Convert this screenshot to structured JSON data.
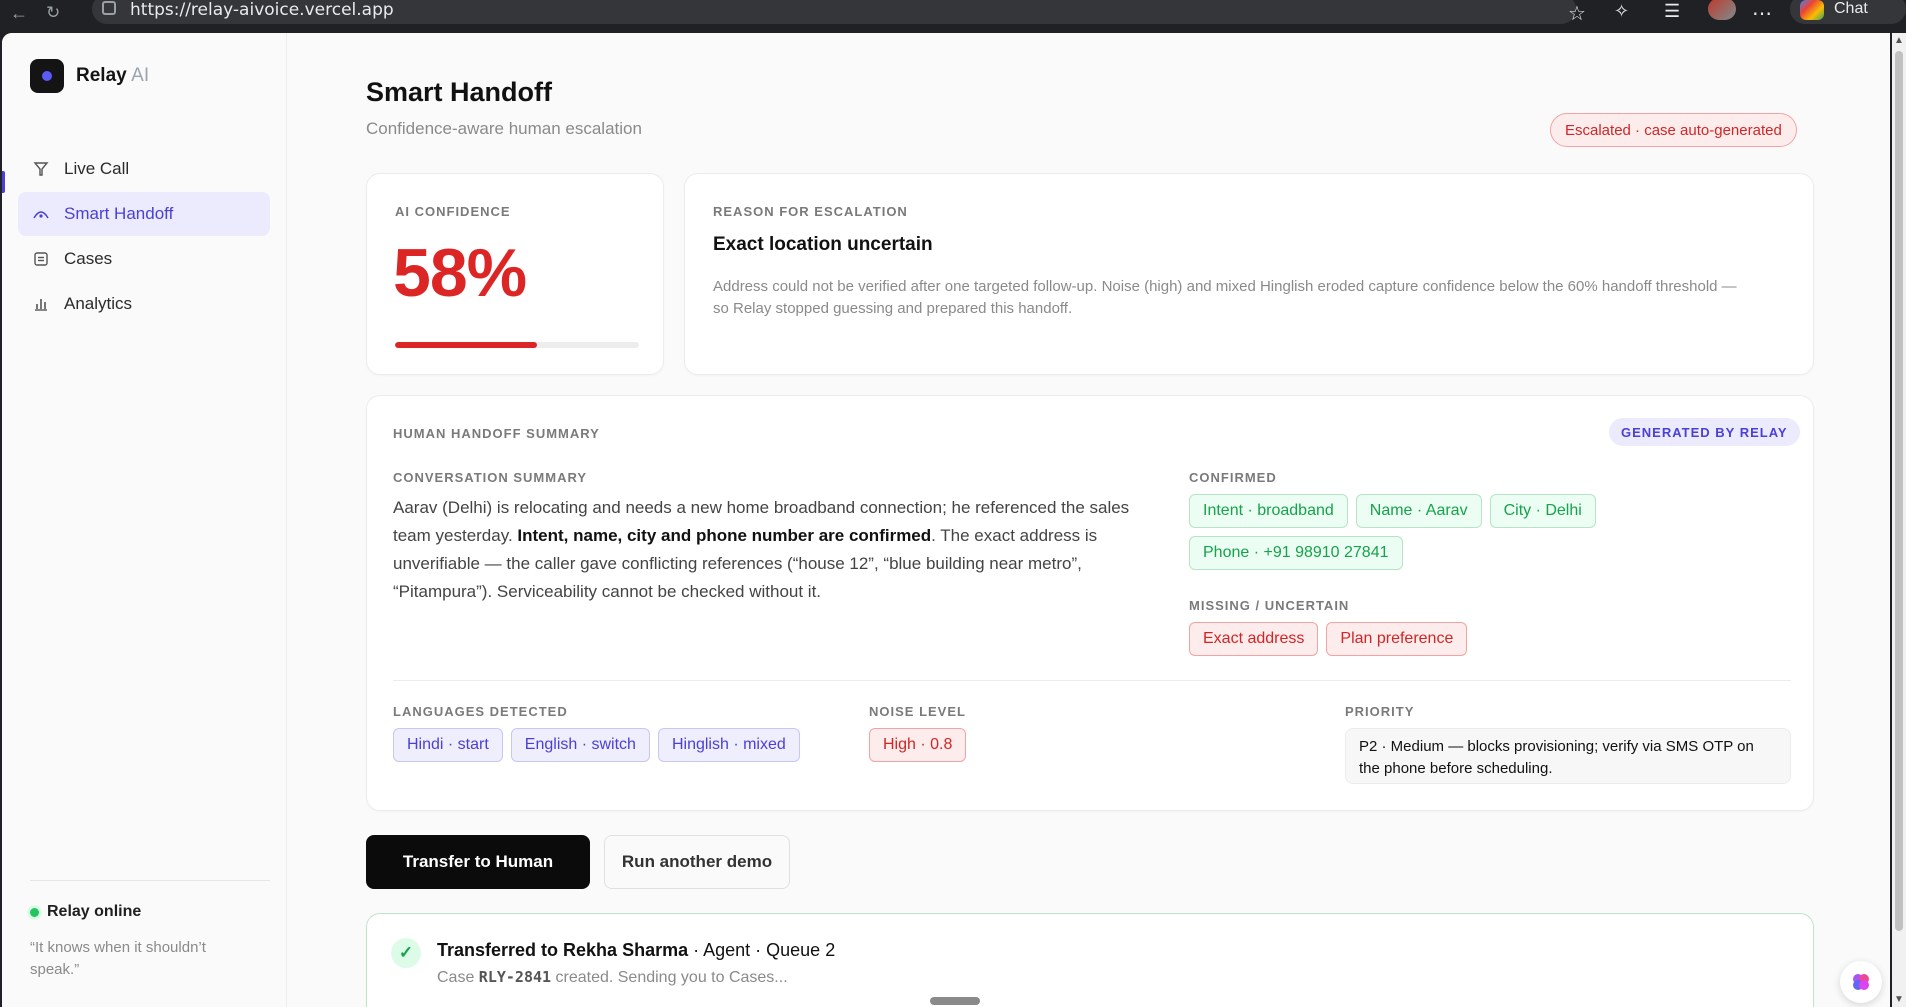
{
  "browser": {
    "url": "https://relay-aivoice.vercel.app",
    "chat_label": "Chat"
  },
  "sidebar": {
    "brand_name": "Relay",
    "brand_suffix": "AI",
    "items": [
      {
        "label": "Live Call",
        "icon": "antenna-icon",
        "active": false
      },
      {
        "label": "Smart Handoff",
        "icon": "handoff-icon",
        "active": true
      },
      {
        "label": "Cases",
        "icon": "case-icon",
        "active": false
      },
      {
        "label": "Analytics",
        "icon": "chart-icon",
        "active": false
      }
    ],
    "status": "Relay online",
    "tagline": "“It knows when it shouldn’t speak.”"
  },
  "header": {
    "title": "Smart Handoff",
    "subtitle": "Confidence-aware human escalation",
    "status_pill": "Escalated · case auto-generated"
  },
  "confidence": {
    "label": "AI CONFIDENCE",
    "value": "58%",
    "fraction": 0.58
  },
  "reason": {
    "label": "REASON FOR ESCALATION",
    "title": "Exact location uncertain",
    "text": "Address could not be verified after one targeted follow-up. Noise (high) and mixed Hinglish eroded capture confidence below the 60% handoff threshold — so Relay stopped guessing and prepared this handoff."
  },
  "summary": {
    "label": "HUMAN HANDOFF SUMMARY",
    "badge": "GENERATED BY RELAY",
    "conversation_label": "CONVERSATION SUMMARY",
    "conversation_part1": "Aarav (Delhi) is relocating and needs a new home broadband connection; he referenced the sales team yesterday. ",
    "conversation_bold": "Intent, name, city and phone number are confirmed",
    "conversation_part2": ". The exact address is unverifiable — the caller gave conflicting references (“house 12”, “blue building near metro”, “Pitampura”). Serviceability cannot be checked without it.",
    "confirmed_label": "CONFIRMED",
    "confirmed": [
      "Intent · broadband",
      "Name · Aarav",
      "City · Delhi",
      "Phone · +91 98910 27841"
    ],
    "missing_label": "MISSING / UNCERTAIN",
    "missing": [
      "Exact address",
      "Plan preference"
    ],
    "languages_label": "LANGUAGES DETECTED",
    "languages": [
      "Hindi · start",
      "English · switch",
      "Hinglish · mixed"
    ],
    "noise_label": "NOISE LEVEL",
    "noise": "High · 0.8",
    "priority_label": "PRIORITY",
    "priority": "P2 · Medium — blocks provisioning; verify via SMS OTP on the phone before scheduling."
  },
  "actions": {
    "primary": "Transfer to Human",
    "secondary": "Run another demo"
  },
  "transfer": {
    "prefix": "Transferred to Rekha Sharma",
    "suffix": " · Agent · Queue 2",
    "case_pre": "Case ",
    "case_id": "RLY-2841",
    "case_post": " created. Sending you to Cases..."
  },
  "colors": {
    "accent": "#4b3fd6",
    "danger": "#dc2626",
    "success": "#16a34a"
  }
}
